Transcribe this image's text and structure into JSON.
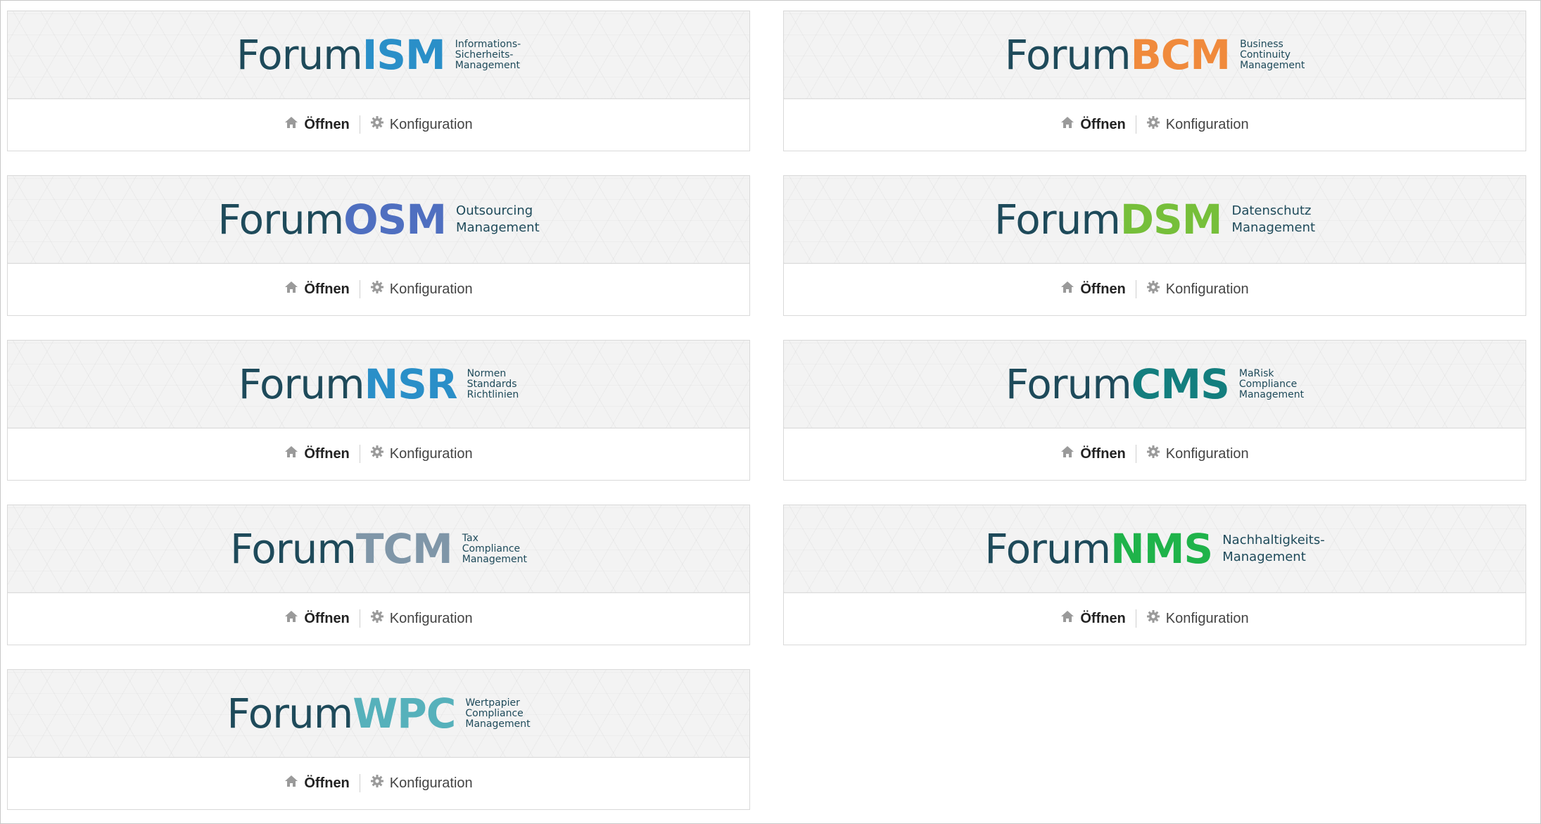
{
  "actions": {
    "open_label": "Öffnen",
    "config_label": "Konfiguration"
  },
  "cards": [
    {
      "prefix": "Forum",
      "acronym": "ISM",
      "color": "#2a8fc8",
      "tagline": [
        "Informations-",
        "Sicherheits-",
        "Management"
      ]
    },
    {
      "prefix": "Forum",
      "acronym": "BCM",
      "color": "#f08a3c",
      "tagline": [
        "Business",
        "Continuity",
        "Management"
      ]
    },
    {
      "prefix": "Forum",
      "acronym": "OSM",
      "color": "#4f6fc0",
      "tagline": [
        "Outsourcing",
        "Management"
      ]
    },
    {
      "prefix": "Forum",
      "acronym": "DSM",
      "color": "#76bf3a",
      "tagline": [
        "Datenschutz",
        "Management"
      ]
    },
    {
      "prefix": "Forum",
      "acronym": "NSR",
      "color": "#2a8fc8",
      "tagline": [
        "Normen",
        "Standards",
        "Richtlinien"
      ]
    },
    {
      "prefix": "Forum",
      "acronym": "CMS",
      "color": "#137e7e",
      "tagline": [
        "MaRisk",
        "Compliance",
        "Management"
      ]
    },
    {
      "prefix": "Forum",
      "acronym": "TCM",
      "color": "#7f96a8",
      "tagline": [
        "Tax",
        "Compliance",
        "Management"
      ]
    },
    {
      "prefix": "Forum",
      "acronym": "NMS",
      "color": "#1fb34a",
      "tagline": [
        "Nachhaltigkeits-",
        "Management"
      ]
    },
    {
      "prefix": "Forum",
      "acronym": "WPC",
      "color": "#56b1bb",
      "tagline": [
        "Wertpapier",
        "Compliance",
        "Management"
      ]
    }
  ]
}
